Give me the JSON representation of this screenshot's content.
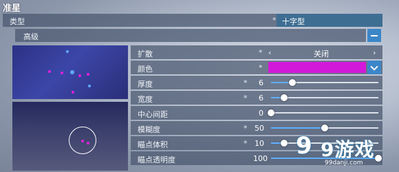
{
  "header": {
    "title": "准星"
  },
  "type_setting": {
    "label": "类型",
    "star": "*",
    "value": "十字型"
  },
  "advanced": {
    "label": "高级"
  },
  "settings": [
    {
      "label": "扩散",
      "star": "*",
      "kind": "selector",
      "value": "关闭",
      "left_arrow": "‹",
      "right_arrow": "›"
    },
    {
      "label": "颜色",
      "star": "*",
      "kind": "color",
      "color": "#d219d9"
    },
    {
      "label": "厚度",
      "star": "*",
      "kind": "slider",
      "value": "6",
      "fraction": 0.2
    },
    {
      "label": "宽度",
      "star": "*",
      "kind": "slider",
      "value": "6",
      "fraction": 0.12
    },
    {
      "label": "中心间距",
      "star": "",
      "kind": "slider",
      "value": "0",
      "fraction": 0.0
    },
    {
      "label": "模糊度",
      "star": "*",
      "kind": "slider",
      "value": "50",
      "fraction": 0.5
    },
    {
      "label": "瞄点体积",
      "star": "*",
      "kind": "slider",
      "value": "10",
      "fraction": 0.12
    },
    {
      "label": "瞄点透明度",
      "star": "",
      "kind": "slider",
      "value": "100",
      "fraction": 1.0
    }
  ],
  "watermark": {
    "mark": "9",
    "text": "9游戏",
    "url": "99danji.com"
  },
  "colors": {
    "accent": "#3c86c8",
    "crosshair": "#d219d9"
  }
}
